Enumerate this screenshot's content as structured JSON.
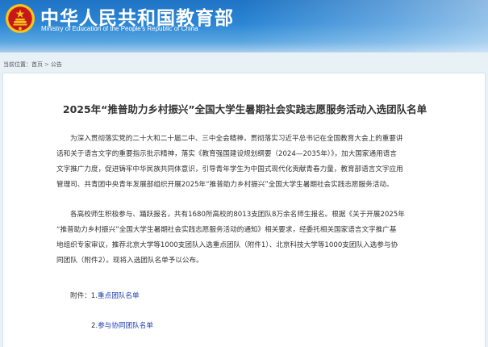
{
  "header": {
    "site_name_cn": "中华人民共和国教育部",
    "site_name_en": "Ministry of Education of the People's Republic of China",
    "emblem_icon": "national-emblem-icon"
  },
  "breadcrumb": {
    "prefix": "当前位置：",
    "home": "首页",
    "separator": ">",
    "current": "公告"
  },
  "article": {
    "title": "2025年“推普助力乡村振兴”全国大学生暑期社会实践志愿服务活动入选团队名单",
    "paragraph1": [
      "为深入贯彻落实党的二十大和二十届二中、三中全会精神，贯彻落实习近平总书记在全国教育大会上的重要讲",
      "话和关于语言文字的重要指示批示精神，落实《教育强国建设规划纲要（2024—2035年）》，加大国家通用语言",
      "文字推广力度，促进铸牢中华民族共同体意识，引导青年学生为中国式现代化贡献青春力量，教育部语言文字应用",
      "管理司、共青团中央青年发展部组织开展2025年“推普助力乡村振兴”全国大学生暑期社会实践志愿服务活动。"
    ],
    "paragraph2": [
      "各高校师生积极参与、踊跃报名，共有1680所高校的8013支团队8万余名师生报名。根据《关于开展2025年",
      "“推普助力乡村振兴”全国大学生暑期社会实践志愿服务活动的通知》相关要求，经委托相关国家语言文字推广基",
      "地组织专家审议，推荐北京大学等1000支团队入选重点团队（附件1）、北京科技大学等1000支团队入选参与协",
      "同团队（附件2）。现将入选团队名单予以公布。"
    ],
    "attachments_label": "附件：",
    "attachment1_number": "1.",
    "attachment1_link": "重点团队名单",
    "attachment2_number": "2.",
    "attachment2_link": "参与协同团队名单"
  },
  "colors": {
    "header_blue": "#1f74c4",
    "emblem_red": "#c8161d",
    "emblem_gold": "#f5c518",
    "link_blue": "#1f3fb0",
    "page_background": "#e8f1f6"
  }
}
